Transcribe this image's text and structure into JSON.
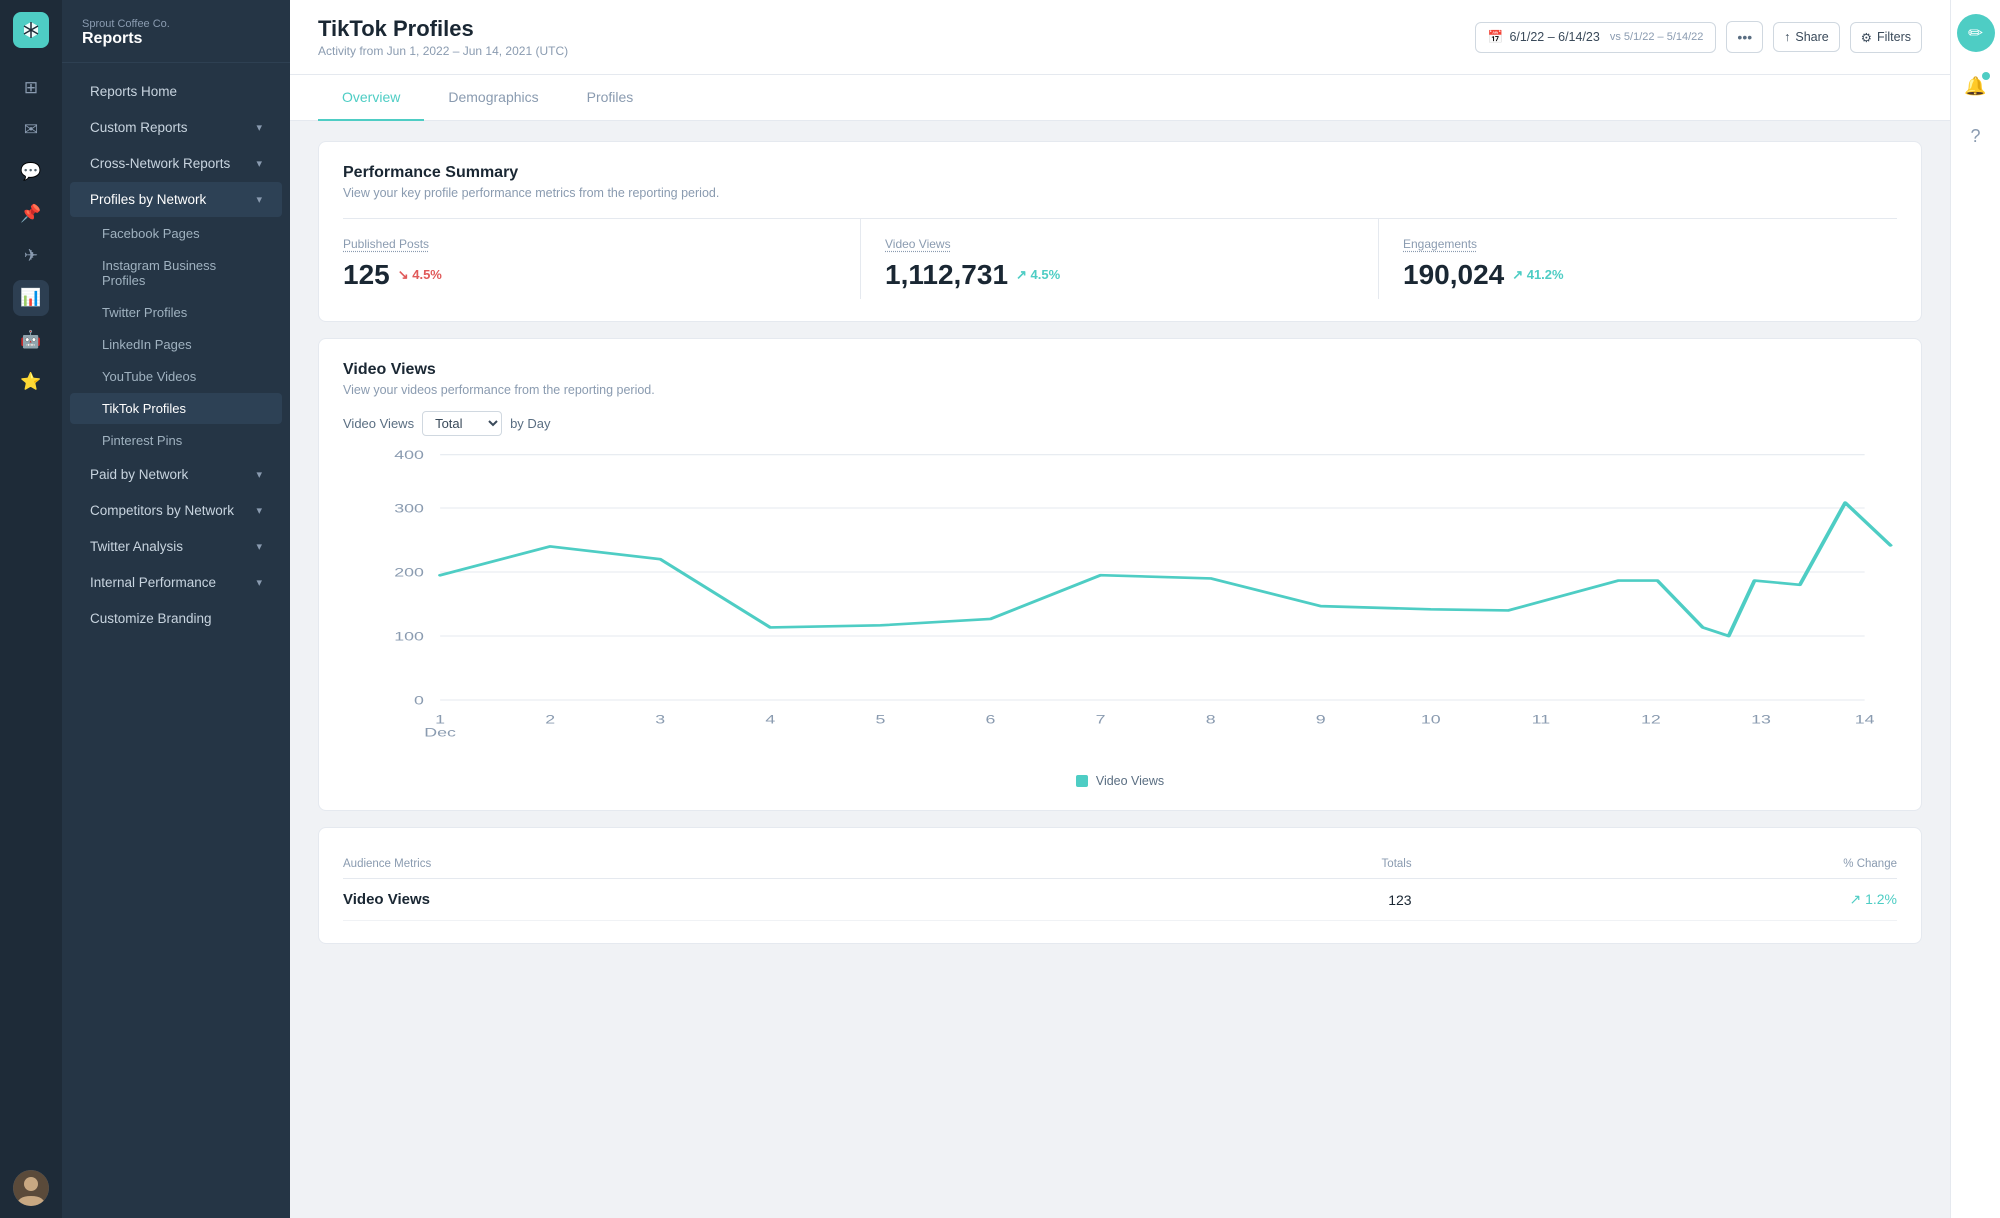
{
  "company": "Sprout Coffee Co.",
  "sidebar_title": "Reports",
  "nav": {
    "reports_home": "Reports Home",
    "custom_reports": "Custom Reports",
    "cross_network_reports": "Cross-Network Reports",
    "profiles_by_network": "Profiles by Network",
    "sub_items": [
      "Facebook Pages",
      "Instagram Business Profiles",
      "Twitter Profiles",
      "LinkedIn Pages",
      "YouTube Videos",
      "TikTok Profiles",
      "Pinterest Pins"
    ],
    "paid_by_network": "Paid by Network",
    "competitors_by_network": "Competitors by Network",
    "twitter_analysis": "Twitter Analysis",
    "internal_performance": "Internal Performance",
    "customize_branding": "Customize Branding"
  },
  "page_title": "TikTok Profiles",
  "activity": "Activity from Jun 1, 2022 – Jun 14, 2021 (UTC)",
  "date_range": "6/1/22 – 6/14/23",
  "vs_date": "vs 5/1/22 – 5/14/22",
  "tabs": [
    "Overview",
    "Demographics",
    "Profiles"
  ],
  "active_tab": "Overview",
  "performance_summary": {
    "title": "Performance Summary",
    "subtitle": "View your key profile performance metrics from the reporting period.",
    "metrics": [
      {
        "label": "Published Posts",
        "value": "125",
        "change": "4.5%",
        "direction": "down"
      },
      {
        "label": "Video Views",
        "value": "1,112,731",
        "change": "4.5%",
        "direction": "up"
      },
      {
        "label": "Engagements",
        "value": "190,024",
        "change": "41.2%",
        "direction": "up"
      }
    ]
  },
  "video_views": {
    "title": "Video Views",
    "subtitle": "View your videos performance from the reporting period.",
    "filter_label": "Video Views",
    "filter_value": "Total",
    "by_label": "by Day",
    "legend": "Video Views",
    "chart": {
      "y_labels": [
        0,
        100,
        200,
        300,
        400
      ],
      "x_labels": [
        "1\nDec",
        "2",
        "3",
        "4",
        "5",
        "6",
        "7",
        "8",
        "9",
        "10",
        "11",
        "12",
        "13",
        "14"
      ],
      "data_points": [
        200,
        230,
        220,
        110,
        115,
        130,
        200,
        195,
        155,
        150,
        145,
        190,
        185,
        110,
        100,
        195,
        310,
        270
      ]
    }
  },
  "audience_metrics": {
    "title": "Audience Metrics",
    "col_totals": "Totals",
    "col_change": "% Change",
    "rows": [
      {
        "name": "Video Views",
        "total": "123",
        "change": "1.2%",
        "direction": "up"
      }
    ]
  },
  "buttons": {
    "share": "Share",
    "filters": "Filters"
  }
}
